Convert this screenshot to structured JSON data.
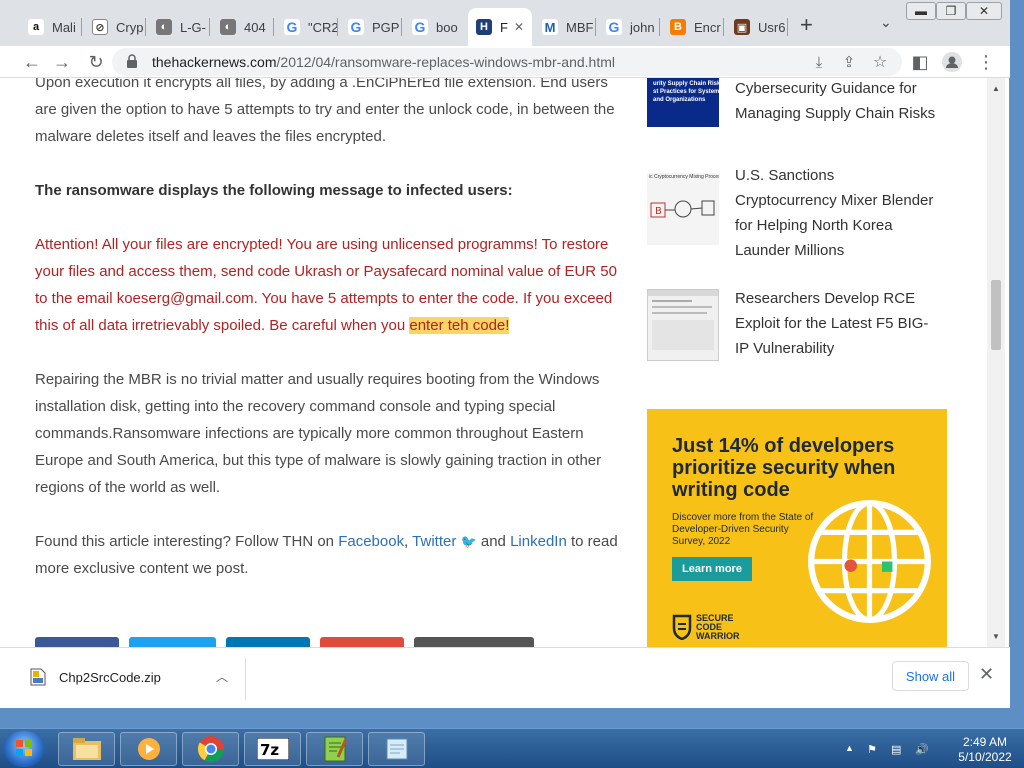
{
  "tabs": [
    {
      "label": "Mali",
      "favicon": "amazon-icon",
      "color": "#ffffff"
    },
    {
      "label": "Cryp",
      "favicon": "tag-icon",
      "color": "#ffffff"
    },
    {
      "label": "L-G-",
      "favicon": "globe-icon",
      "color": "#ffffff"
    },
    {
      "label": "404",
      "favicon": "globe-icon",
      "color": "#ffffff"
    },
    {
      "label": "\"CR2",
      "favicon": "google-icon",
      "color": "#ffffff"
    },
    {
      "label": "PGP",
      "favicon": "google-icon",
      "color": "#ffffff"
    },
    {
      "label": "boo",
      "favicon": "google-icon",
      "color": "#ffffff"
    },
    {
      "label": "F",
      "favicon": "thn-icon",
      "color": "#ffffff"
    },
    {
      "label": "MBF",
      "favicon": "malwarebytes-icon",
      "color": "#ffffff"
    },
    {
      "label": "john",
      "favicon": "google-icon",
      "color": "#ffffff"
    },
    {
      "label": "Encr",
      "favicon": "blogger-icon",
      "color": "#ffffff"
    },
    {
      "label": "Usr6",
      "favicon": "bookmark-icon",
      "color": "#ffffff"
    }
  ],
  "url": {
    "host": "thehackernews.com",
    "path": "/2012/04/ransomware-replaces-windows-mbr-and.html"
  },
  "article": {
    "p1": "Upon execution it encrypts all files, by adding a .EnCiPhErEd file extension. End users are given the option to have 5 attempts to try and enter the unlock code, in between the malware deletes itself and leaves the files encrypted.",
    "p2": "The ransomware displays the following message to infected users:",
    "p3_main": "Attention! All your files are encrypted! You are using unlicensed programms! To restore your files and access them, send code Ukrash or Paysafecard nominal value of EUR 50 to the email koeserg@gmail.com. You have 5 attempts to enter the code. If you exceed this of all data irretrievably spoiled. Be careful when you ",
    "p3_highlight": "enter teh code!",
    "p4": "Repairing the MBR is no trivial matter and usually requires booting from the Windows installation disk, getting into the recovery command console and typing special commands.Ransomware infections are typically more common throughout Eastern Europe and South America, but this type of malware is slowly gaining traction in other regions of the world as well.",
    "p5_pre": "Found this article interesting? Follow THN on ",
    "p5_facebook": "Facebook",
    "p5_comma": ", ",
    "p5_twitter": "Twitter",
    "p5_and": " and ",
    "p5_linkedin": "LinkedIn",
    "p5_post": " to read more exclusive content we post."
  },
  "share_colors": [
    "#3b5998",
    "#1da1f2",
    "#0077b5",
    "#e14b3b",
    "#555555"
  ],
  "sidebar": {
    "items": [
      {
        "title": "Cybersecurity Guidance for Managing Supply Chain Risks",
        "thumb_text": "urity Supply Chain Risk\nst Practices for Systems\nand Organizations"
      },
      {
        "title": "U.S. Sanctions Cryptocurrency Mixer Blender for Helping North Korea Launder Millions",
        "thumb_text": "ic Cryptocurrency Mixing Process"
      },
      {
        "title": "Researchers Develop RCE Exploit for the Latest F5 BIG-IP Vulnerability",
        "thumb_text": ""
      }
    ],
    "ad": {
      "title": "Just 14% of developers prioritize security when writing code",
      "subtitle": "Discover more from the State of Developer-Driven Security Survey, 2022",
      "button": "Learn more",
      "brand": "SECURE\nCODE\nWARRIOR",
      "colors": {
        "bg": "#f7c117",
        "button": "#1b9c9c",
        "text": "#1e2a3a"
      }
    }
  },
  "download": {
    "filename": "Chp2SrcCode.zip",
    "show_all": "Show all"
  },
  "taskbar": {
    "time": "2:49 AM",
    "date": "5/10/2022"
  }
}
